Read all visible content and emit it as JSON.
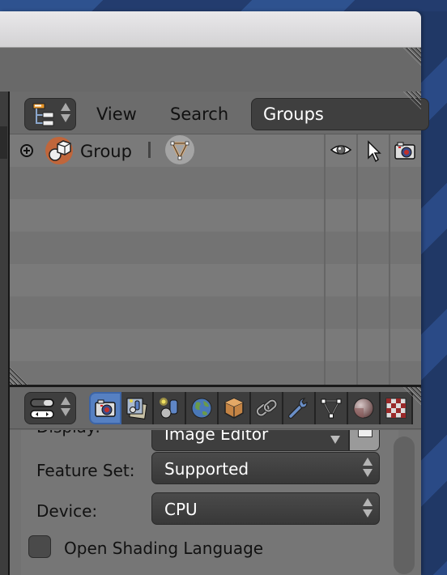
{
  "outliner": {
    "header": {
      "editor_type_icon": "outliner-icon",
      "menus": [
        "View",
        "Search"
      ],
      "display_mode": "Groups"
    },
    "rows": [
      {
        "label": "Group",
        "expand_icon": "plus-circle-icon",
        "type_icon": "group-icon",
        "data_icon": "mesh-ngon-icon",
        "restrict_icons": [
          "eye-icon",
          "cursor-icon",
          "camera-icon"
        ]
      }
    ],
    "empty_rows": 7
  },
  "properties": {
    "header": {
      "editor_type_icon": "properties-icon",
      "tabs": [
        {
          "name": "render",
          "icon": "camera-icon",
          "active": true
        },
        {
          "name": "render-layers",
          "icon": "render-layers-icon",
          "active": false
        },
        {
          "name": "scene",
          "icon": "scene-icon",
          "active": false
        },
        {
          "name": "world",
          "icon": "world-icon",
          "active": false
        },
        {
          "name": "object",
          "icon": "cube-icon",
          "active": false
        },
        {
          "name": "constraints",
          "icon": "link-icon",
          "active": false
        },
        {
          "name": "modifiers",
          "icon": "wrench-icon",
          "active": false
        },
        {
          "name": "data",
          "icon": "mesh-data-icon",
          "active": false
        },
        {
          "name": "material",
          "icon": "material-icon",
          "active": false
        },
        {
          "name": "texture",
          "icon": "texture-icon",
          "active": false
        }
      ]
    },
    "fields": {
      "display": {
        "label": "Display:",
        "value": "Image Editor"
      },
      "feature_set": {
        "label": "Feature Set:",
        "value": "Supported"
      },
      "device": {
        "label": "Device:",
        "value": "CPU"
      },
      "osl": {
        "label": "Open Shading Language",
        "checked": false
      }
    }
  },
  "colors": {
    "active_tab": "#5680c2",
    "group_icon": "#c0663b",
    "panel_bg": "#767676"
  }
}
